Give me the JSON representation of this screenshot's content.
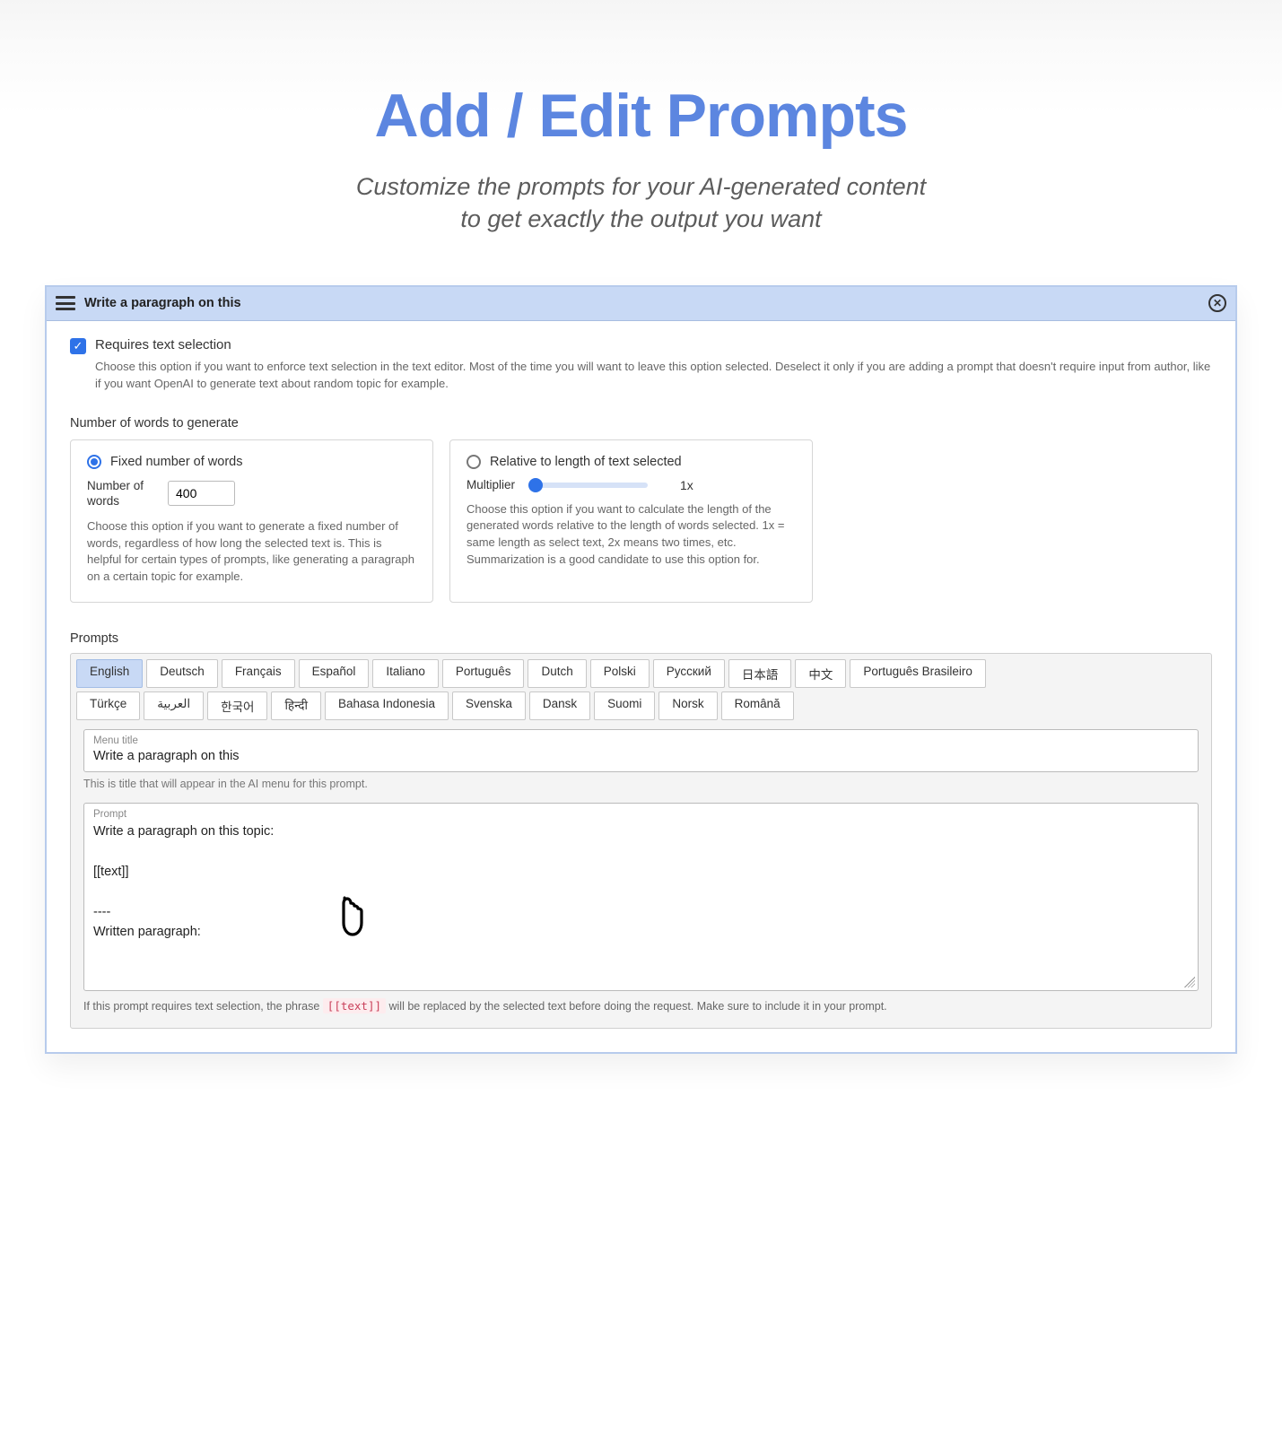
{
  "page": {
    "title": "Add / Edit Prompts",
    "subtitle_line1": "Customize the prompts for your AI-generated content",
    "subtitle_line2": "to get exactly the output you want"
  },
  "panel": {
    "header_title": "Write a paragraph on this",
    "requires_selection": {
      "checked": true,
      "label": "Requires text selection",
      "help": "Choose this option if you want to enforce text selection in the text editor. Most of the time you will want to leave this option selected. Deselect it only if you are adding a prompt that doesn't require input from author, like if you want OpenAI to generate text about random topic for example."
    },
    "words_section_label": "Number of words to generate",
    "fixed": {
      "radio_label": "Fixed number of words",
      "selected": true,
      "num_label": "Number of words",
      "value": "400",
      "help": "Choose this option if you want to generate a fixed number of words, regardless of how long the selected text is. This is helpful for certain types of prompts, like generating a paragraph on a certain topic for example."
    },
    "relative": {
      "radio_label": "Relative to length of text selected",
      "selected": false,
      "multiplier_label": "Multiplier",
      "multiplier_value": "1x",
      "help": "Choose this option if you want to calculate the length of the generated words relative to the length of words selected. 1x = same length as select text, 2x means two times, etc. Summarization is a good candidate to use this option for."
    },
    "prompts_label": "Prompts",
    "tabs_row1": [
      "English",
      "Deutsch",
      "Français",
      "Español",
      "Italiano",
      "Português",
      "Dutch",
      "Polski",
      "Русский",
      "日本語",
      "中文",
      "Português Brasileiro"
    ],
    "tabs_row2": [
      "Türkçe",
      "العربية",
      "한국어",
      "हिन्दी",
      "Bahasa Indonesia",
      "Svenska",
      "Dansk",
      "Suomi",
      "Norsk",
      "Română"
    ],
    "active_tab": "English",
    "menu_title": {
      "label": "Menu title",
      "value": "Write a paragraph on this",
      "help": "This is title that will appear in the AI menu for this prompt."
    },
    "prompt_field": {
      "label": "Prompt",
      "value": "Write a paragraph on this topic:\n\n[[text]]\n\n----\nWritten paragraph:",
      "help_before": "If this prompt requires text selection, the phrase ",
      "help_code": "[[text]]",
      "help_after": " will be replaced by the selected text before doing the request. Make sure to include it in your prompt."
    }
  }
}
